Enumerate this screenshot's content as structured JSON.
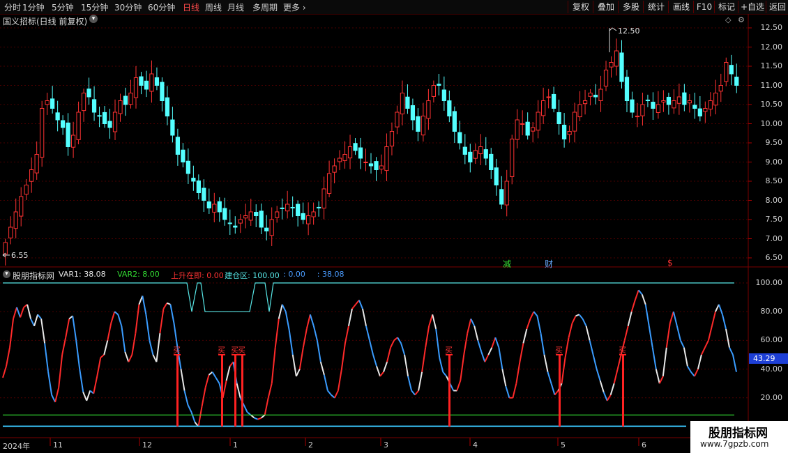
{
  "toolbar": {
    "periods": [
      "分时",
      "1分钟",
      "5分钟",
      "15分钟",
      "30分钟",
      "60分钟",
      "日线",
      "周线",
      "月线",
      "多周期",
      "更多"
    ],
    "active_period": "日线",
    "right_buttons": [
      "复权",
      "叠加",
      "多股",
      "统计",
      "画线",
      "F10",
      "标记",
      "+自选",
      "返回"
    ]
  },
  "main": {
    "title": "国义招标(日线 前复权)",
    "high_label": "12.50",
    "low_label": "6.55",
    "price_ticks": [
      "12.50",
      "12.00",
      "11.50",
      "11.00",
      "10.50",
      "10.00",
      "9.50",
      "9.00",
      "8.50",
      "8.00",
      "7.50",
      "7.00",
      "6.50"
    ],
    "events": [
      {
        "text": "减",
        "color": "#33dd33"
      },
      {
        "text": "财",
        "color": "#66aaff"
      },
      {
        "text": "$",
        "color": "#ff3333"
      }
    ]
  },
  "indicator": {
    "name": "股朋指标网",
    "items": [
      {
        "label": "VAR1: 38.08",
        "color": "#e6e6e6"
      },
      {
        "label": "VAR2: 8.00",
        "color": "#33dd33"
      },
      {
        "label": "上升在即: 0.00",
        "color": "#ff3333"
      },
      {
        "label": "建仓区: 100.00",
        "color": "#58e8e8"
      },
      {
        "label": ": 0.00",
        "color": "#4a9cff"
      },
      {
        "label": ": 38.08",
        "color": "#4a9cff"
      }
    ],
    "ticks": [
      "100.00",
      "80.00",
      "60.00",
      "40.00",
      "20.00"
    ],
    "current_value": "43.29",
    "buy_label": "买"
  },
  "date_axis": {
    "labels": [
      "2024年",
      "11",
      "12",
      "1",
      "2",
      "3",
      "4",
      "5",
      "6"
    ]
  },
  "watermark": {
    "line1": "股朋指标网",
    "line2": "www.7gpzb.com"
  },
  "colors": {
    "up": "#ff3232",
    "down": "#54ffff",
    "background": "#000000",
    "grid": "#4a0000"
  },
  "chart_data": [
    {
      "type": "candlestick",
      "title": "国义招标(日线 前复权)",
      "ylim": [
        6.4,
        12.8
      ],
      "close": [
        6.9,
        7.3,
        7.7,
        8.1,
        8.4,
        8.8,
        9.2,
        10.4,
        10.6,
        10.4,
        10.1,
        9.9,
        9.4,
        9.7,
        10.3,
        10.8,
        10.7,
        10.3,
        10.2,
        10.0,
        9.9,
        10.3,
        10.6,
        10.5,
        10.8,
        11.2,
        11.0,
        10.9,
        11.3,
        11.0,
        10.6,
        10.2,
        9.7,
        9.2,
        9.0,
        8.7,
        8.5,
        8.2,
        8.0,
        7.8,
        7.9,
        7.7,
        7.5,
        7.4,
        7.3,
        7.5,
        7.6,
        7.7,
        7.6,
        7.3,
        7.2,
        7.5,
        7.7,
        7.8,
        7.9,
        7.8,
        7.6,
        7.5,
        7.6,
        7.7,
        7.8,
        8.3,
        8.7,
        8.9,
        9.1,
        9.2,
        9.4,
        9.3,
        9.1,
        9.0,
        8.9,
        8.8,
        8.9,
        9.4,
        9.8,
        10.3,
        10.8,
        10.4,
        10.1,
        9.8,
        10.2,
        10.6,
        11.0,
        11.0,
        10.6,
        10.2,
        9.8,
        9.5,
        9.2,
        9.0,
        9.3,
        9.4,
        9.1,
        8.8,
        8.4,
        7.9,
        8.5,
        9.6,
        10.1,
        10.0,
        9.7,
        9.9,
        10.3,
        10.6,
        10.7,
        10.4,
        10.0,
        9.6,
        9.8,
        10.3,
        10.5,
        10.6,
        10.8,
        10.7,
        10.9,
        11.4,
        11.6,
        11.9,
        11.1,
        10.6,
        10.3,
        10.2,
        10.5,
        10.6,
        10.4,
        10.5,
        10.6,
        10.5,
        10.6,
        10.7,
        10.5,
        10.6,
        10.4,
        10.2,
        10.4,
        10.6,
        10.8,
        11.0,
        11.6,
        11.3,
        11.0
      ],
      "labels": {
        "high": 12.5,
        "low": 6.55
      }
    },
    {
      "type": "line",
      "ylim": [
        0,
        110
      ],
      "ticks": [
        100,
        80,
        60,
        40,
        20
      ],
      "series": [
        {
          "name": "VAR1",
          "last": 38.08
        },
        {
          "name": "VAR2",
          "last": 8.0
        },
        {
          "name": "上升在即",
          "last": 0.0
        },
        {
          "name": "建仓区",
          "last": 100.0
        }
      ],
      "values": [
        34,
        42,
        55,
        75,
        83,
        76,
        83,
        85,
        75,
        70,
        78,
        75,
        58,
        38,
        22,
        17,
        27,
        50,
        62,
        75,
        77,
        60,
        40,
        24,
        18,
        25,
        23,
        35,
        48,
        50,
        60,
        72,
        80,
        78,
        70,
        52,
        45,
        50,
        65,
        85,
        91,
        78,
        60,
        50,
        45,
        65,
        82,
        86,
        85,
        72,
        55,
        40,
        25,
        15,
        10,
        3,
        0,
        14,
        27,
        36,
        38,
        34,
        30,
        20,
        32,
        42,
        45,
        30,
        20,
        15,
        10,
        8,
        6,
        5,
        6,
        8,
        20,
        30,
        55,
        75,
        85,
        80,
        67,
        50,
        35,
        40,
        55,
        68,
        78,
        70,
        60,
        45,
        36,
        25,
        22,
        20,
        25,
        40,
        58,
        70,
        82,
        85,
        88,
        82,
        70,
        60,
        50,
        42,
        35,
        38,
        45,
        55,
        60,
        62,
        58,
        50,
        35,
        25,
        22,
        25,
        38,
        55,
        70,
        78,
        68,
        48,
        38,
        35,
        30,
        25,
        25,
        32,
        50,
        65,
        75,
        70,
        60,
        52,
        45,
        50,
        55,
        62,
        55,
        40,
        28,
        20,
        20,
        30,
        45,
        58,
        68,
        75,
        80,
        77,
        65,
        50,
        38,
        30,
        22,
        25,
        30,
        48,
        62,
        72,
        77,
        78,
        75,
        70,
        60,
        50,
        40,
        32,
        24,
        18,
        22,
        30,
        40,
        50,
        60,
        70,
        80,
        88,
        95,
        92,
        85,
        70,
        55,
        40,
        30,
        35,
        55,
        72,
        80,
        70,
        60,
        55,
        42,
        38,
        35,
        40,
        50,
        55,
        60,
        70,
        80,
        85,
        78,
        68,
        55,
        50,
        38
      ]
    }
  ]
}
